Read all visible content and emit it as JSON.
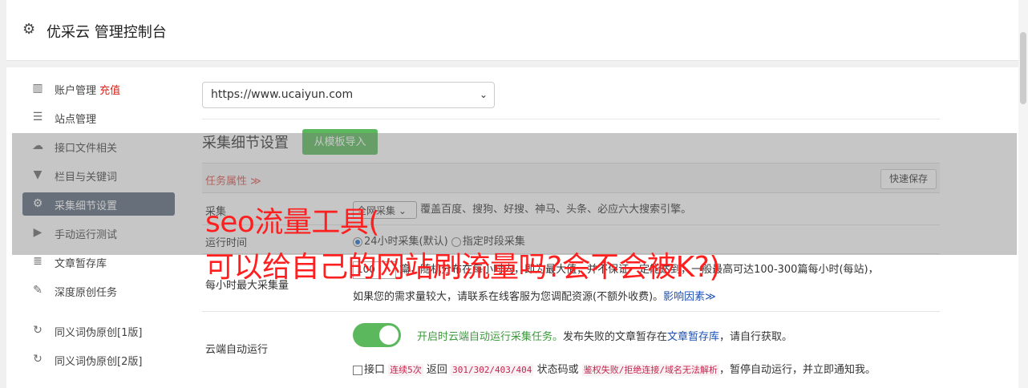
{
  "header": {
    "title": "优采云 管理控制台",
    "icon": "gear-icon"
  },
  "sidebar": {
    "items": [
      {
        "label": "账户管理",
        "extra": "充值",
        "icon": "bar-chart-icon"
      },
      {
        "label": "站点管理",
        "icon": "server-icon"
      },
      {
        "label": "接口文件相关",
        "icon": "cloud-upload-icon"
      },
      {
        "label": "栏目与关键词",
        "icon": "filter-icon"
      },
      {
        "label": "采集细节设置",
        "icon": "cogs-icon",
        "active": true
      },
      {
        "label": "手动运行测试",
        "icon": "play-circle-icon"
      },
      {
        "label": "文章暂存库",
        "icon": "database-icon"
      },
      {
        "label": "深度原创任务",
        "icon": "edit-icon"
      },
      {
        "label": "同义词伪原创[1版]",
        "icon": "refresh-icon"
      },
      {
        "label": "同义词伪原创[2版]",
        "icon": "refresh-icon"
      }
    ]
  },
  "site_select": {
    "value": "https://www.ucaiyun.com"
  },
  "section": {
    "title": "采集细节设置",
    "template_button": "从模板导入"
  },
  "form": {
    "task_props": "任务属性 ≫",
    "quick_save": "快速保存",
    "collect_label": "采集",
    "collect_select": "全网采集",
    "collect_desc": "覆盖百度、搜狗、好搜、神马、头条、必应六大搜索引擎。",
    "run_time_label": "运行时间",
    "run_opt1": "24小时采集(默认)",
    "run_opt2": "指定时段采集",
    "max_label": "每小时最大采集量",
    "max_value": "100",
    "max_desc_a": "篇，随机分布在每小时内，即为最大值，并不保证一定能达到，一般最高可达100-300篇每小时(每站)，",
    "max_desc_b": "如果您的需求量较大，请联系在线客服为您调配资源(不额外收费)。",
    "max_link": "影响因素≫",
    "cloud_label": "云端自动运行",
    "cloud_desc_green": "开启时云端自动运行采集任务。",
    "cloud_desc_mid": "发布失败的文章暂存在",
    "cloud_link": "文章暂存库",
    "cloud_desc_end": "，请自行获取。",
    "interface_text_a": "接口",
    "code1": "连续5次",
    "interface_text_b": "返回",
    "code2": "301/302/403/404",
    "interface_text_c": "状态码或",
    "code3": "鉴权失败/拒绝连接/域名无法解析",
    "interface_text_d": "，暂停自动运行，并立即通知我。"
  },
  "overlay_text": {
    "line1": "seo流量工具(",
    "line2": "可以给自己的网站刷流量吗?会不会被K?)"
  }
}
